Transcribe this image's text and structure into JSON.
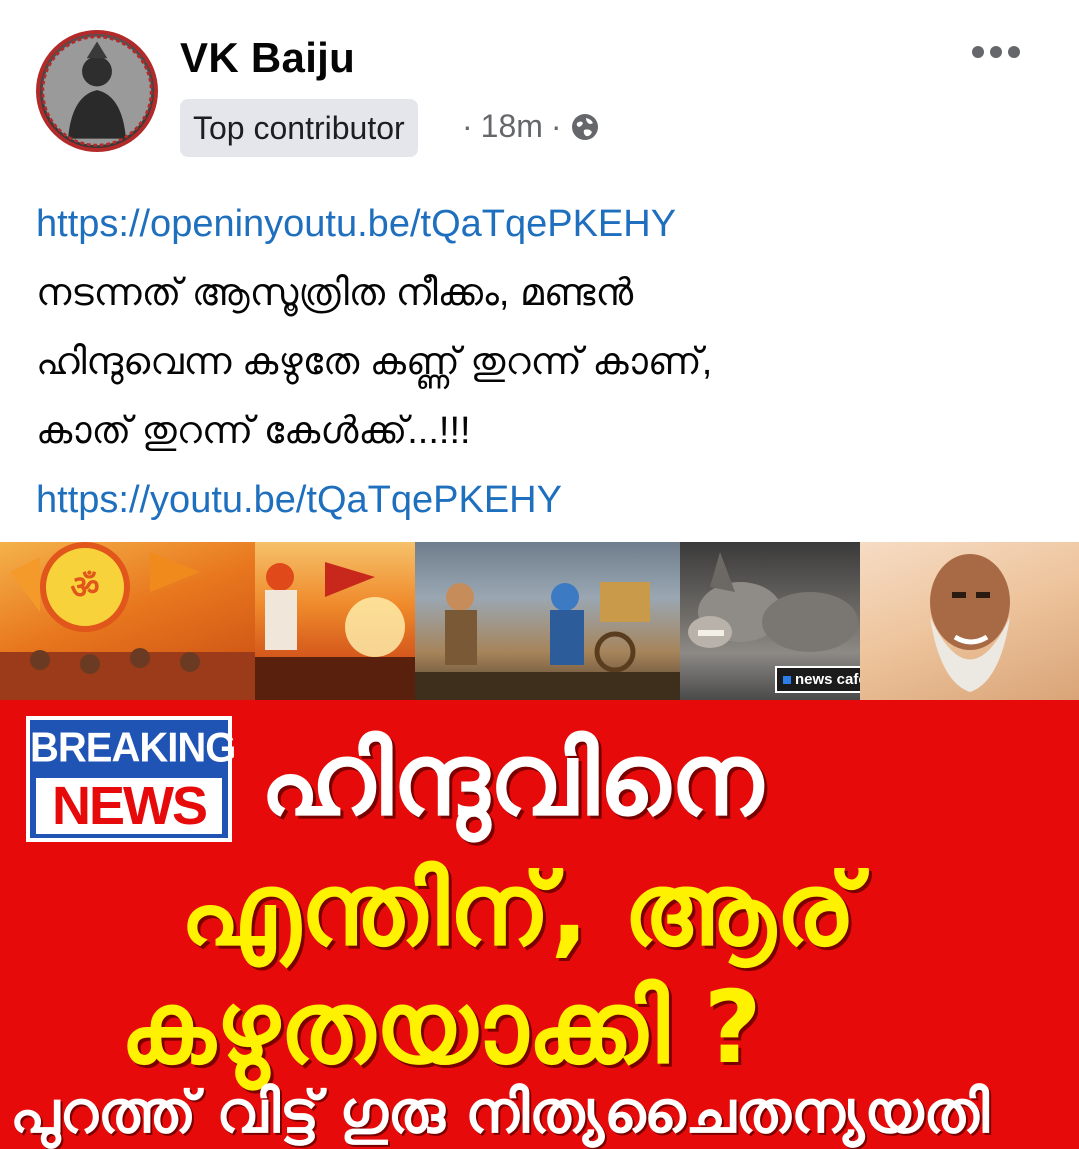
{
  "post": {
    "author_name": "VK Baiju",
    "badge": "Top contributor",
    "separator1": "·",
    "time": "18m",
    "separator2": "·",
    "privacy_icon": "globe-icon",
    "more_icon": "more-options-icon"
  },
  "content": {
    "link1": "https://openinyoutu.be/tQaTqePKEHY",
    "line1": "നടന്നത് ആസൂത്രിത നീക്കം, മണ്ടൻ",
    "line2": "ഹിന്ദുവെന്ന കഴുതേ കണ്ണ് തുറന്ന് കാണ്,",
    "line3": "കാത് തുറന്ന് കേൾക്ക്...!!!",
    "link2": "https://youtu.be/tQaTqePKEHY"
  },
  "media": {
    "live_tag": "news cafe LIVE",
    "breaking_top": "BREAKING",
    "breaking_bottom": "NEWS",
    "headline1": "ഹിന്ദുവിനെ",
    "headline2": "എന്തിന്, ആര്",
    "headline3": "കഴുതയാക്കി ?",
    "headline4": "പുറത്ത് വിട്ട് ഗുരു നിത്യചൈതന്യയതി"
  },
  "colors": {
    "link": "#1f6fbf",
    "banner_red": "#e60a0a",
    "headline_yellow": "#fff200",
    "breaking_blue": "#1f54b5"
  }
}
